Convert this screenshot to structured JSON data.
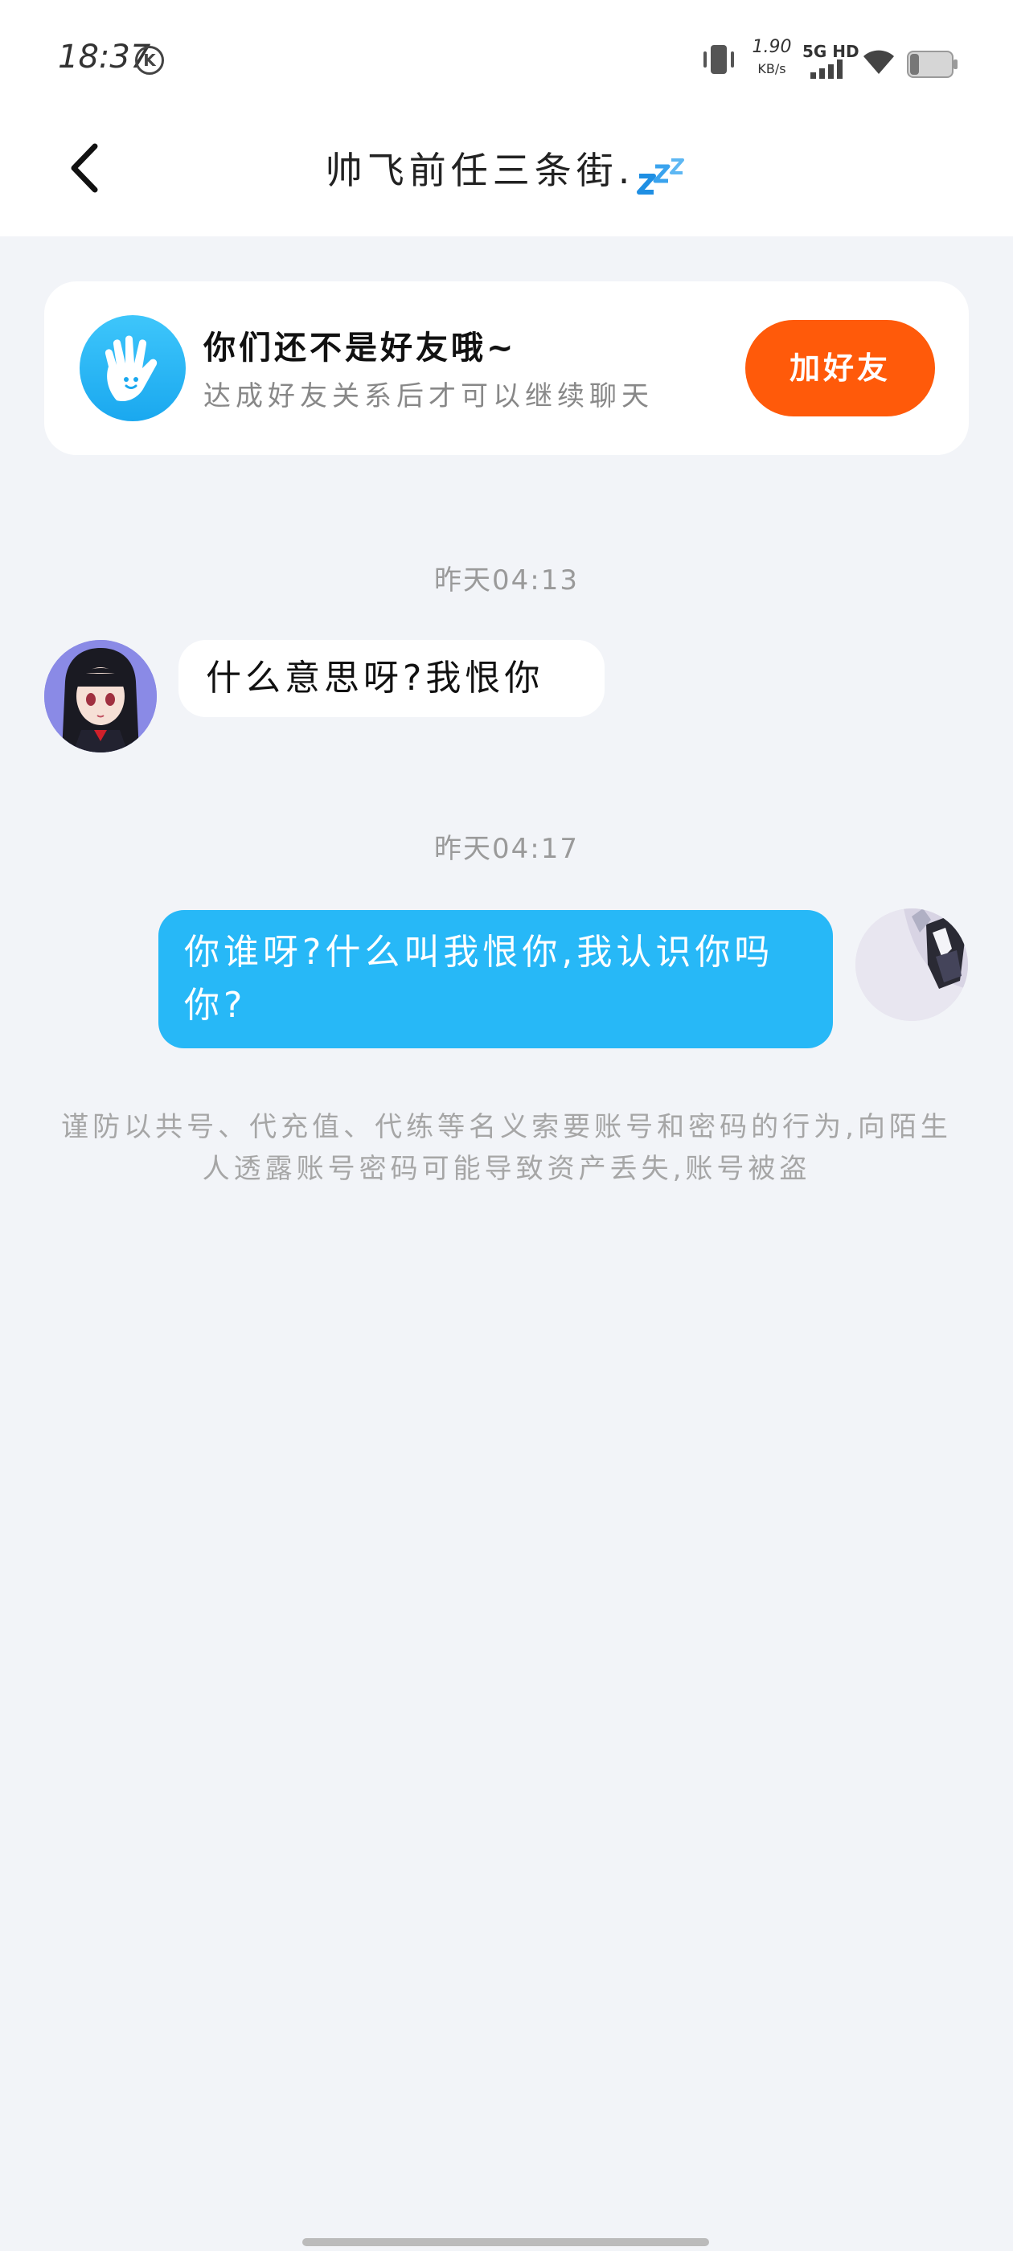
{
  "status_bar": {
    "time": "18:37",
    "k_icon_label": "K",
    "net_speed_value": "1.90",
    "net_speed_unit": "KB/s",
    "network_type": "5G HD",
    "icons": [
      "vibrate-icon",
      "signal-icon",
      "wifi-icon",
      "battery-icon"
    ]
  },
  "header": {
    "title": "帅飞前任三条街.",
    "title_icon": "zzz-icon",
    "back_icon": "chevron-left-icon"
  },
  "friend_banner": {
    "title": "你们还不是好友哦~",
    "subtitle": "达成好友关系后才可以继续聊天",
    "button_label": "加好友",
    "icon": "waving-hand-icon",
    "button_color": "#ff5a0a"
  },
  "messages": [
    {
      "timestamp": "昨天04:13",
      "sender": "other",
      "text": "什么意思呀?我恨你"
    },
    {
      "timestamp": "昨天04:17",
      "sender": "self",
      "text": "你谁呀?什么叫我恨你,我认识你吗你?"
    }
  ],
  "security_notice": "谨防以共号、代充值、代练等名义索要账号和密码的行为,向陌生人透露账号密码可能导致资产丢失,账号被盗",
  "colors": {
    "accent_blue": "#27b8f7",
    "background": "#f2f4f8",
    "orange": "#ff5a0a"
  }
}
